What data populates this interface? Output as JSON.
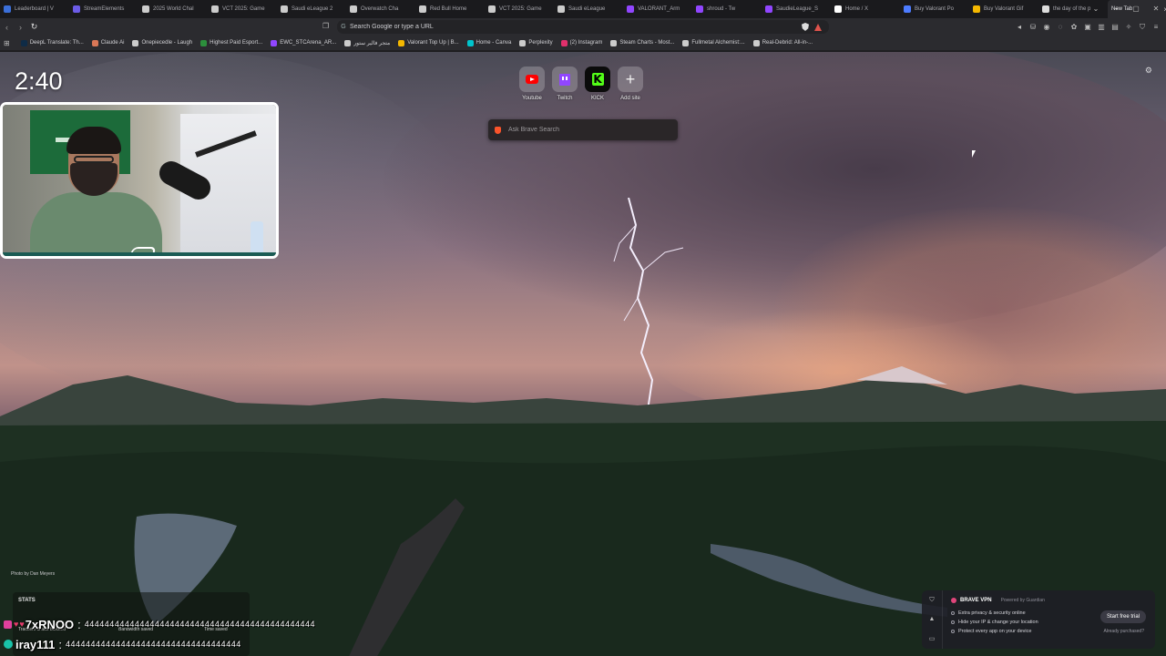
{
  "tabs": [
    {
      "title": "Leaderboard | V",
      "color": "#3b6fd8"
    },
    {
      "title": "StreamElements",
      "color": "#6c5ce7"
    },
    {
      "title": "2025 World Chal",
      "color": "#cccccc"
    },
    {
      "title": "VCT 2025: Game",
      "color": "#cccccc"
    },
    {
      "title": "Saudi eLeague 2",
      "color": "#cccccc"
    },
    {
      "title": "Overwatch Cha",
      "color": "#cccccc"
    },
    {
      "title": "Red Bull Home",
      "color": "#cccccc"
    },
    {
      "title": "VCT 2025: Game",
      "color": "#cccccc"
    },
    {
      "title": "Saudi eLeague",
      "color": "#cccccc"
    },
    {
      "title": "VALORANT_Arm",
      "color": "#9146ff"
    },
    {
      "title": "shroud - Tw",
      "color": "#9146ff"
    },
    {
      "title": "SaudieLeague_S",
      "color": "#9146ff"
    },
    {
      "title": "Home / X",
      "color": "#ffffff"
    },
    {
      "title": "Buy Valorant Po",
      "color": "#4d7cff"
    },
    {
      "title": "Buy Valorant Gif",
      "color": "#f5b800"
    },
    {
      "title": "the day of the p",
      "color": "#dddddd"
    }
  ],
  "active_tab": {
    "title": "New Tab"
  },
  "address_bar": {
    "placeholder": "Search Google or type a URL"
  },
  "bookmarks": [
    {
      "label": "DeepL Translate: Th...",
      "color": "#0f2b46"
    },
    {
      "label": "Claude Ai",
      "color": "#d97757"
    },
    {
      "label": "Onepiecedle - Laugh",
      "color": "#cccccc"
    },
    {
      "label": "Highest Paid Esport...",
      "color": "#2c8f3c"
    },
    {
      "label": "EWC_STCArena_AR...",
      "color": "#9146ff"
    },
    {
      "label": "متجر فالير ستور",
      "color": "#cccccc"
    },
    {
      "label": "Valorant Top Up | B...",
      "color": "#f5b800"
    },
    {
      "label": "Home - Canva",
      "color": "#00c4cc"
    },
    {
      "label": "Perplexity",
      "color": "#cccccc"
    },
    {
      "label": "(2) Instagram",
      "color": "#e1306c"
    },
    {
      "label": "Steam Charts - Most...",
      "color": "#cccccc"
    },
    {
      "label": "Fullmetal Alchemist:...",
      "color": "#cccccc"
    },
    {
      "label": "Real-Debrid: All-in-...",
      "color": "#cccccc"
    }
  ],
  "speed_dial": [
    {
      "label": "Youtube",
      "icon": "youtube-icon"
    },
    {
      "label": "Twitch",
      "icon": "twitch-icon"
    },
    {
      "label": "KICK",
      "icon": "kick-icon"
    },
    {
      "label": "Add site",
      "icon": "plus-icon"
    }
  ],
  "search": {
    "placeholder": "Ask Brave Search"
  },
  "clock": "2:40",
  "photo_credit": "Photo by Dan Meyers",
  "stats": {
    "title": "STATS",
    "labels": [
      "Trackers & ads blocked",
      "Bandwidth saved",
      "Time saved"
    ]
  },
  "chat": [
    {
      "user": "7xRNOO",
      "msg": "4444444444444444444444444444444444444444444444"
    },
    {
      "user": "iray111",
      "msg": "44444444444444444444444444444444444"
    }
  ],
  "vpn": {
    "name": "BRAVE VPN",
    "powered": "Powered by Guardian",
    "features": [
      "Extra privacy & security online",
      "Hide your IP & change your location",
      "Protect every app on your device"
    ],
    "cta": "Start free trial",
    "already": "Already purchased?"
  },
  "colors": {
    "brave_orange": "#fb542b",
    "youtube_red": "#ff0000",
    "twitch_purple": "#9146ff",
    "kick_green": "#53fc18"
  }
}
